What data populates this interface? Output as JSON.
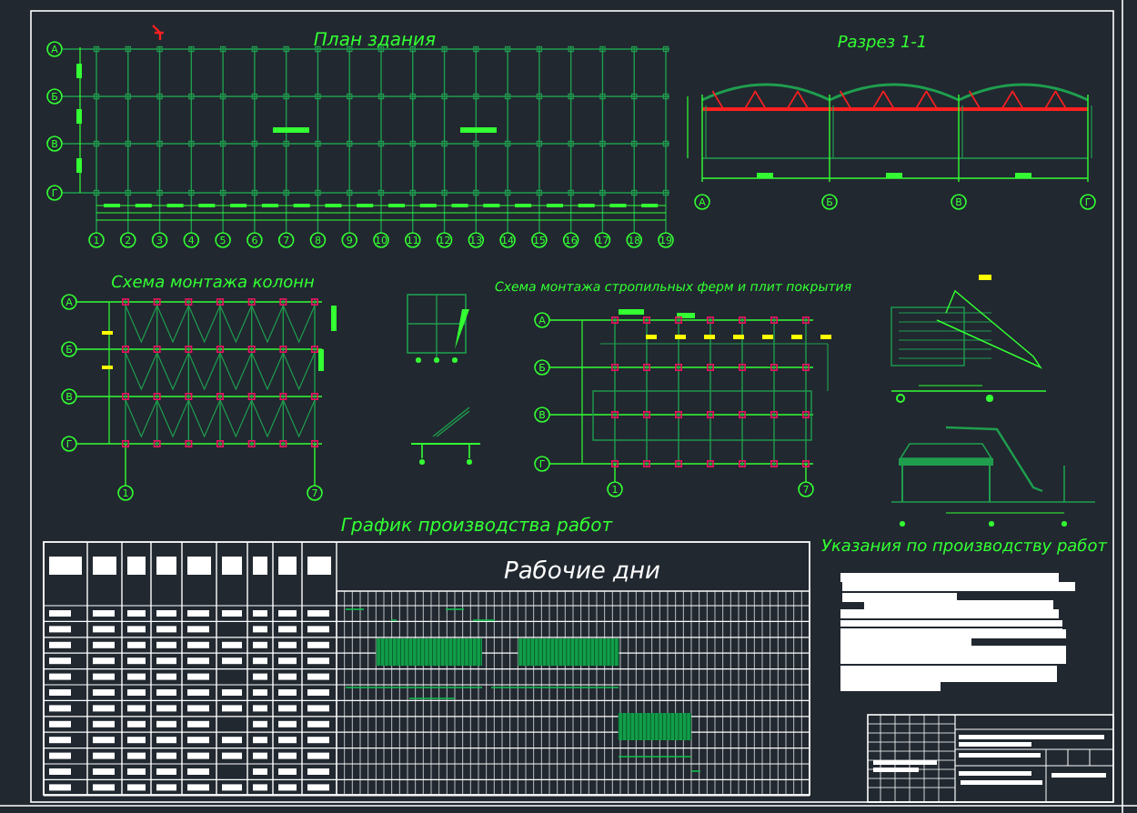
{
  "plan": {
    "title": "План здания",
    "row_axes": [
      "А",
      "Б",
      "В",
      "Г"
    ],
    "column_axes": [
      "1",
      "2",
      "3",
      "4",
      "5",
      "6",
      "7",
      "8",
      "9",
      "10",
      "11",
      "12",
      "13",
      "14",
      "15",
      "16",
      "17",
      "18",
      "19"
    ]
  },
  "section": {
    "title": "Разрез 1-1",
    "axes": [
      "А",
      "Б",
      "В",
      "Г"
    ]
  },
  "column_scheme": {
    "title": "Схема монтажа колонн",
    "row_axes": [
      "А",
      "Б",
      "В",
      "Г"
    ],
    "column_axes": [
      "1",
      "7"
    ]
  },
  "truss_scheme": {
    "title": "Схема монтажа стропильных ферм и плит покрытия",
    "row_axes": [
      "А",
      "Б",
      "В",
      "Г"
    ],
    "column_axes": [
      "1",
      "7"
    ]
  },
  "schedule": {
    "title": "График производства работ",
    "days_header": "Рабочие дни"
  },
  "instructions": {
    "title": "Указания по производству работ"
  }
}
